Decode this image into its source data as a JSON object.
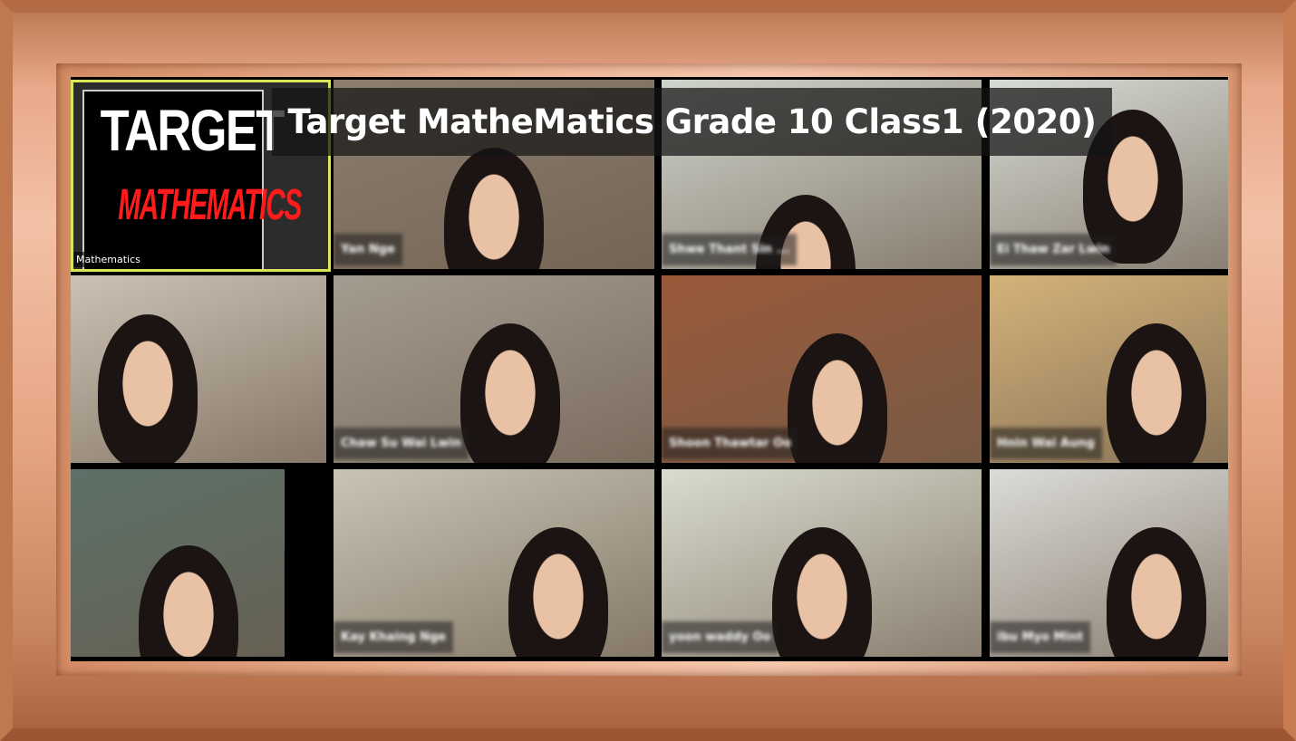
{
  "title": "Target MatheMatics Grade 10 Class1 (2020)",
  "logo": {
    "line1": "TARGET",
    "line2": "MATHEMATICS",
    "label": "Mathematics"
  },
  "participants": [
    {
      "name": "Yan Nge",
      "bg": "#8c7f70"
    },
    {
      "name": "Shwe Thant Sin ...",
      "bg": "#cfd4cc"
    },
    {
      "name": "Ei Thaw Zar Lwin",
      "bg": "#d7dcd6"
    },
    {
      "name": "",
      "bg": "#cbc2b4"
    },
    {
      "name": "Chaw Su Wai Lwin",
      "bg": "#a49c90"
    },
    {
      "name": "Shoon Thawtar Oo",
      "bg": "#9a5a3a"
    },
    {
      "name": "Hnin Wai Aung",
      "bg": "#d4b27a"
    },
    {
      "name": "",
      "bg": "#5c7168"
    },
    {
      "name": "Kay Khaing Nge",
      "bg": "#c8c4b4"
    },
    {
      "name": "yoon waddy Oo",
      "bg": "#d9dccf"
    },
    {
      "name": "ibu Myo Mint",
      "bg": "#dcdcd8"
    }
  ],
  "colors": {
    "active_speaker_border": "#d9e65a",
    "frame": "#e5a482"
  }
}
